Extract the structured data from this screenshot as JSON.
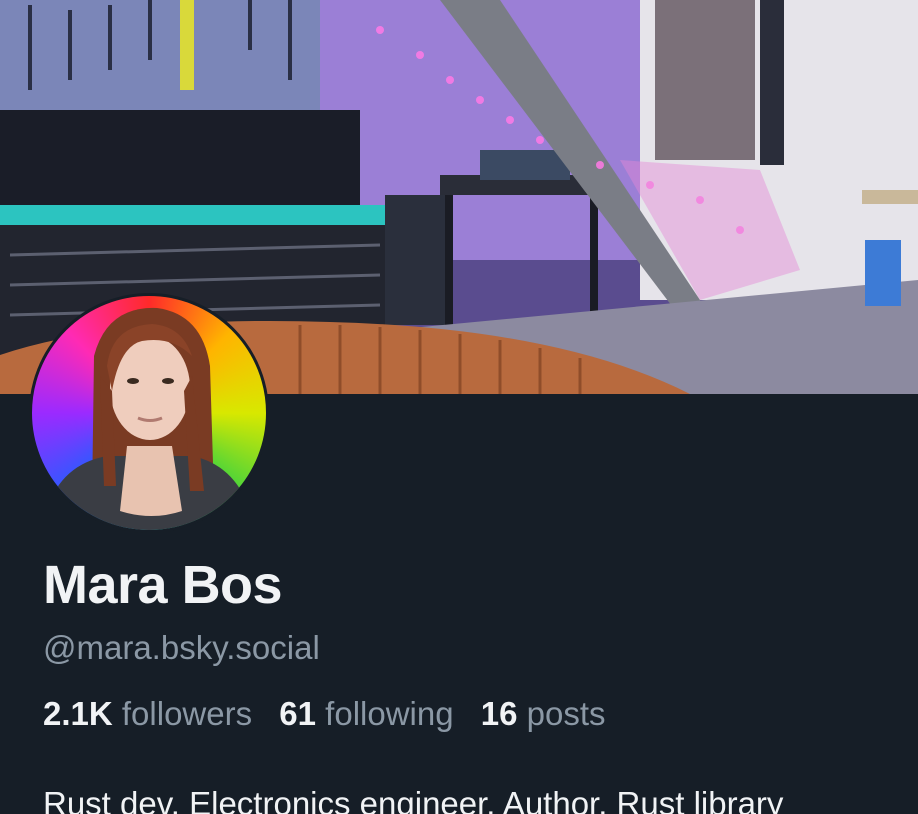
{
  "profile": {
    "display_name": "Mara Bos",
    "handle": "@mara.bsky.social",
    "bio": "Rust dev. Electronics engineer. Author. Rust library"
  },
  "stats": {
    "followers_count": "2.1K",
    "followers_label": "followers",
    "following_count": "61",
    "following_label": "following",
    "posts_count": "16",
    "posts_label": "posts"
  },
  "colors": {
    "background": "#161e27",
    "text_primary": "#f1f3f5",
    "text_secondary": "#8b98a5"
  }
}
